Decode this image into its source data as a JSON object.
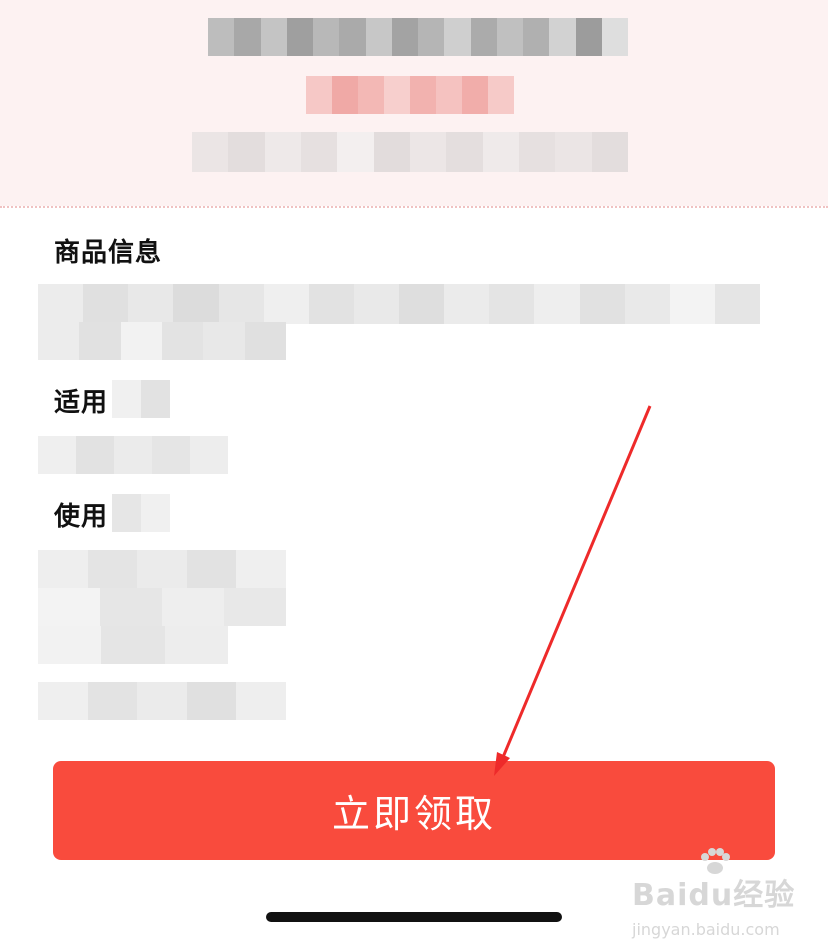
{
  "sections": {
    "goods_info": "商品信息",
    "applicable": "适用",
    "usage": "使用"
  },
  "claim_button": {
    "label": "立即领取"
  },
  "watermark": {
    "brand": "Baidu经验",
    "url": "jingyan.baidu.com"
  },
  "colors": {
    "accent_red": "#f94b3d",
    "header_bg": "#fdf2f2",
    "arrow_red": "#ee2a2a"
  }
}
